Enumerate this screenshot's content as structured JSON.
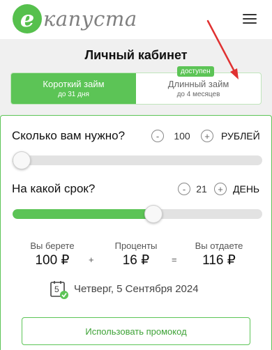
{
  "header": {
    "logo_letter": "е",
    "logo_text": "капуста",
    "menu_icon": "hamburger-icon"
  },
  "page_title": "Личный кабинет",
  "tabs": [
    {
      "label": "Короткий займ",
      "sub": "до 31 дня",
      "active": true
    },
    {
      "label": "Длинный займ",
      "sub": "до 4 месяцев",
      "active": false,
      "badge": "доступен"
    }
  ],
  "calculator": {
    "amount": {
      "label": "Сколько вам нужно?",
      "value": "100",
      "unit": "РУБЛЕЙ",
      "minus": "-",
      "plus": "+",
      "slider_fraction": 0.0
    },
    "term": {
      "label": "На какой срок?",
      "value": "21",
      "unit": "ДЕНЬ",
      "minus": "-",
      "plus": "+",
      "slider_fraction": 0.57
    },
    "summary": {
      "take_label": "Вы берете",
      "take_value": "100 ₽",
      "plus_sign": "+",
      "interest_label": "Проценты",
      "interest_value": "16 ₽",
      "equals_sign": "=",
      "return_label": "Вы отдаете",
      "return_value": "116 ₽"
    },
    "calendar_day": "5",
    "due_date": "Четверг, 5 Сентября 2024",
    "promo_button": "Использовать промокод"
  },
  "colors": {
    "accent": "#5cc456",
    "annotation_arrow": "#e03131"
  }
}
